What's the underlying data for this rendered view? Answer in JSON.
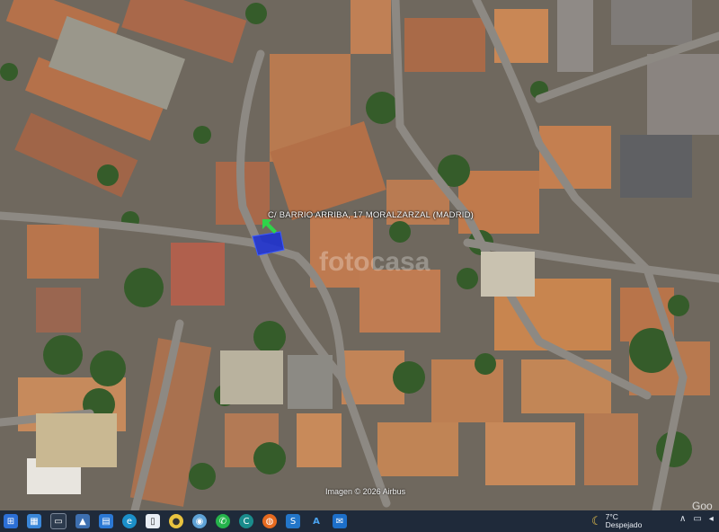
{
  "map": {
    "address_label": "C/ BARRIO ARRIBA, 17  MORALZARZAL (MADRID)",
    "watermark": "fotocasa",
    "copyright": "Imagen © 2026 Airbus",
    "google_mark": "Goo",
    "marker_color": "#1a2fd6",
    "arrow_color": "#2fd34a"
  },
  "taskbar": {
    "icons": [
      "windows-start-icon",
      "calendar-icon",
      "screen-icon",
      "photos-icon",
      "windows-store-icon",
      "edge-icon",
      "document-icon",
      "chrome-icon",
      "firefox-alt-icon",
      "whatsapp-icon",
      "copilot-icon",
      "firefox-icon",
      "s-app-icon",
      "altium-icon",
      "mail-icon"
    ],
    "weather": {
      "temp": "7°C",
      "desc": "Despejado"
    }
  }
}
